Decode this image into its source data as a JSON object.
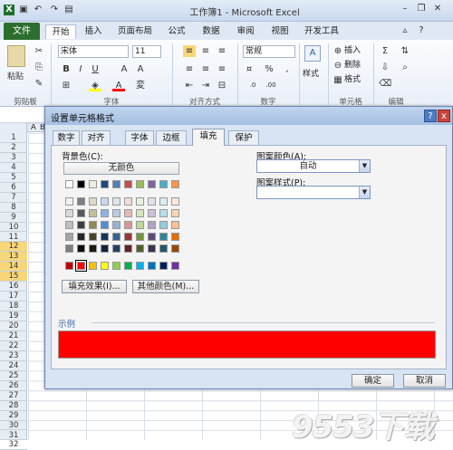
{
  "window": {
    "title": "工作簿1 - Microsoft Excel"
  },
  "ribbon_tabs": [
    "文件",
    "开始",
    "插入",
    "页面布局",
    "公式",
    "数据",
    "审阅",
    "视图",
    "开发工具"
  ],
  "ribbon": {
    "font_name": "宋体",
    "font_size": "11",
    "number_format": "常规",
    "paste_label": "粘贴",
    "style_label": "样式",
    "insert_label": "插入",
    "delete_label": "删除",
    "format_label": "格式",
    "groups": [
      "剪贴板",
      "字体",
      "对齐方式",
      "数字",
      "单元格",
      "编辑"
    ],
    "percent_symbol": "%",
    "comma_symbol": ",",
    "sum_symbol": "Σ"
  },
  "sheet": {
    "col_a": "A",
    "col_b": "B",
    "rows": [
      "1",
      "2",
      "3",
      "4",
      "5",
      "6",
      "7",
      "8",
      "9",
      "10",
      "11",
      "12",
      "13",
      "14",
      "15",
      "16",
      "17",
      "18",
      "19",
      "20",
      "21",
      "22",
      "23",
      "24",
      "25",
      "26",
      "27",
      "28",
      "29",
      "30",
      "31",
      "32"
    ],
    "selected_rows": [
      "12",
      "13",
      "14",
      "15"
    ]
  },
  "dialog": {
    "title": "设置单元格格式",
    "tabs": [
      "数字",
      "对齐",
      "字体",
      "边框",
      "填充",
      "保护"
    ],
    "active_tab": "填充",
    "background_color_label": "背景色(C):",
    "no_color_button": "无颜色",
    "pattern_color_label": "图案颜色(A):",
    "pattern_color_value": "自动",
    "pattern_style_label": "图案样式(P):",
    "pattern_style_value": "",
    "fill_effects_button": "填充效果(I)...",
    "more_colors_button": "其他颜色(M)...",
    "sample_label": "示例",
    "sample_color": "#ff0000",
    "ok_button": "确定",
    "cancel_button": "取消",
    "help_glyph": "?",
    "close_glyph": "x"
  },
  "palette": {
    "theme_top": [
      "#ffffff",
      "#000000",
      "#eeece1",
      "#1f497d",
      "#4f81bd",
      "#c0504d",
      "#9bbb59",
      "#8064a2",
      "#4bacc6",
      "#f79646"
    ],
    "theme_shades": [
      [
        "#f2f2f2",
        "#7f7f7f",
        "#ddd9c3",
        "#c6d9f0",
        "#dbe5f1",
        "#f2dcdb",
        "#ebf1dd",
        "#e5e0ec",
        "#dbeef3",
        "#fdeada"
      ],
      [
        "#d8d8d8",
        "#595959",
        "#c4bd97",
        "#8db3e2",
        "#b8cce4",
        "#e5b9b7",
        "#d7e3bc",
        "#ccc1d9",
        "#b7dde8",
        "#fbd5b5"
      ],
      [
        "#bfbfbf",
        "#3f3f3f",
        "#938953",
        "#548dd4",
        "#95b3d7",
        "#d99694",
        "#c3d69b",
        "#b2a2c7",
        "#92cddc",
        "#fac08f"
      ],
      [
        "#a5a5a5",
        "#262626",
        "#494429",
        "#17365d",
        "#366092",
        "#953734",
        "#76923c",
        "#5f497a",
        "#31859b",
        "#e36c09"
      ],
      [
        "#7f7f7f",
        "#0c0c0c",
        "#1d1b10",
        "#0f243e",
        "#244061",
        "#632423",
        "#4f6128",
        "#3f3151",
        "#205867",
        "#974806"
      ]
    ],
    "standard": [
      "#c00000",
      "#ff0000",
      "#ffc000",
      "#ffff00",
      "#92d050",
      "#00b050",
      "#00b0f0",
      "#0070c0",
      "#002060",
      "#7030a0"
    ],
    "selected_standard": 1
  },
  "watermark": "9553下载"
}
